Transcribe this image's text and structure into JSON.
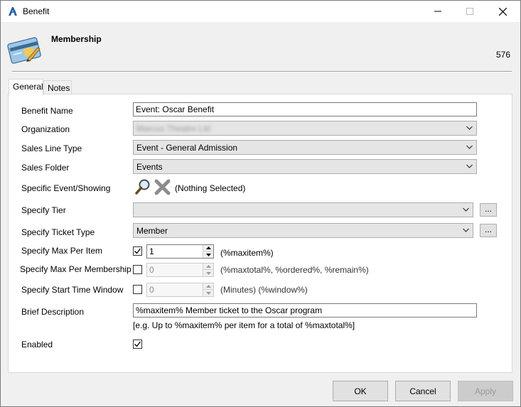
{
  "window": {
    "title": "Benefit"
  },
  "header": {
    "title": "Membership",
    "record_id": "576"
  },
  "tabs": [
    {
      "label": "General"
    },
    {
      "label": "Notes"
    }
  ],
  "form": {
    "benefit_name": {
      "label": "Benefit Name",
      "value": "Event: Oscar Benefit"
    },
    "organization": {
      "label": "Organization",
      "value": "Marcus Theatre Ltd"
    },
    "sales_line_type": {
      "label": "Sales Line Type",
      "value": "Event - General Admission"
    },
    "sales_folder": {
      "label": "Sales Folder",
      "value": "Events"
    },
    "specific_event": {
      "label": "Specific Event/Showing",
      "value": "(Nothing Selected)"
    },
    "specify_tier": {
      "label": "Specify Tier",
      "value": "",
      "button": "..."
    },
    "ticket_type": {
      "label": "Specify Ticket Type",
      "value": "Member",
      "button": "..."
    },
    "max_per_item": {
      "label": "Specify Max Per Item",
      "checked": true,
      "value": "1",
      "hint": "(%maxitem%)"
    },
    "max_per_membership": {
      "label": "Specify Max Per Membership",
      "checked": false,
      "value": "0",
      "hint": "(%maxtotal%, %ordered%, %remain%)"
    },
    "start_time_window": {
      "label": "Specify Start Time Window",
      "checked": false,
      "value": "0",
      "hint": "(Minutes) (%window%)"
    },
    "brief_description": {
      "label": "Brief Description",
      "value": "%maxitem% Member ticket to the Oscar program",
      "hint": "[e.g. Up to %maxitem% per item for a total of %maxtotal%]"
    },
    "enabled": {
      "label": "Enabled",
      "checked": true
    }
  },
  "buttons": {
    "ok": "OK",
    "cancel": "Cancel",
    "apply": "Apply"
  },
  "colors": {
    "accent": "#1e5fb4",
    "panel": "#ffffff",
    "disabled_text": "#9a9a9a"
  }
}
